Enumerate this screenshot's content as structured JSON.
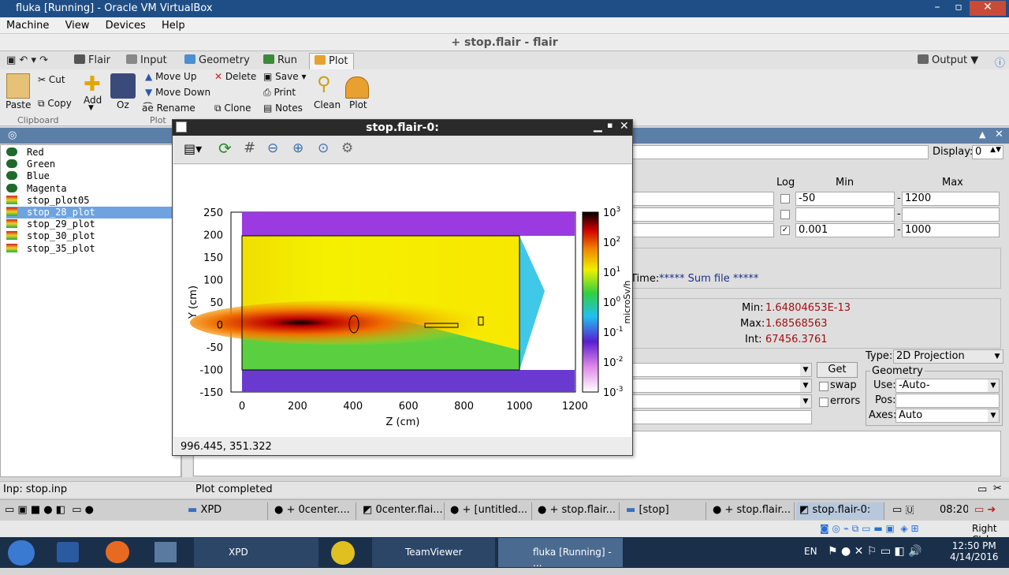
{
  "vbox": {
    "title": "fluka [Running] - Oracle VM VirtualBox",
    "menu": [
      "Machine",
      "View",
      "Devices",
      "Help"
    ]
  },
  "flair": {
    "title": "+ stop.flair - flair",
    "tabs": [
      "Flair",
      "Input",
      "Geometry",
      "Run",
      "Plot"
    ],
    "output_label": "Output",
    "ribbon": {
      "paste": "Paste",
      "cut": "Cut",
      "copy": "Copy",
      "add": "Add",
      "oz": "Oz",
      "move_up": "Move Up",
      "move_down": "Move Down",
      "rename": "Rename",
      "delete": "Delete",
      "clone": "Clone",
      "save": "Save",
      "print": "Print",
      "notes": "Notes",
      "clean": "Clean",
      "plot": "Plot",
      "sec_clipboard": "Clipboard",
      "sec_plot": "Plot"
    },
    "plot_list": [
      {
        "name": "Red",
        "kind": "pot"
      },
      {
        "name": "Green",
        "kind": "pot"
      },
      {
        "name": "Blue",
        "kind": "pot"
      },
      {
        "name": "Magenta",
        "kind": "pot"
      },
      {
        "name": "stop_plot05",
        "kind": "usr"
      },
      {
        "name": "stop_28_plot",
        "kind": "usr",
        "selected": true
      },
      {
        "name": "stop_29_plot",
        "kind": "usr"
      },
      {
        "name": "stop_30_plot",
        "kind": "usr"
      },
      {
        "name": "stop_35_plot",
        "kind": "usr"
      }
    ],
    "right": {
      "display_label": "Display:",
      "display_value": "0",
      "col_log": "Log",
      "col_min": "Min",
      "col_max": "Max",
      "row1": {
        "log": false,
        "min": "-50",
        "max": "1200"
      },
      "row2": {
        "log": false,
        "min": "",
        "max": ""
      },
      "row3": {
        "log": true,
        "min": "0.001",
        "max": "1000"
      },
      "time_label": "Time:",
      "time_value": "***** Sum file *****",
      "min_label": "Min:",
      "min_value": "1.64804653E-13",
      "max_label": "Max:",
      "max_value": "1.68568563",
      "int_label": "Int:",
      "int_value": "67456.3761",
      "type_label": "Type:",
      "type_value": "2D Projection",
      "get": "Get",
      "swap": "swap",
      "errors": "errors",
      "geometry": "Geometry",
      "use_label": "Use:",
      "use_value": "-Auto-",
      "pos_label": "Pos:",
      "axes_label": "Axes:",
      "axes_value": "Auto"
    },
    "status_left": "Inp: stop.inp",
    "status_right": "Plot completed"
  },
  "plotwin": {
    "title": "stop.flair-0:",
    "coords": "996.445,  351.322",
    "xlabel": "Z (cm)",
    "ylabel": "Y (cm)",
    "cblabel": "microSv/h",
    "xticks": [
      "0",
      "200",
      "400",
      "600",
      "800",
      "1000",
      "1200"
    ],
    "yticks": [
      "250",
      "200",
      "150",
      "100",
      "50",
      "0",
      "-50",
      "-100",
      "-150"
    ],
    "cbticks": [
      "3",
      "2",
      "1",
      "0",
      "-1",
      "-2",
      "-3"
    ]
  },
  "guest_taskbar": {
    "items": [
      "XPD",
      "+ 0center....",
      "0center.flai...",
      "+ [untitled...",
      "+ stop.flair...",
      "[stop]",
      "+ stop.flair...",
      "stop.flair-0:"
    ],
    "clock": "08:20"
  },
  "vb_status": {
    "hostkey": "Right Ctrl"
  },
  "win_taskbar": {
    "items": [
      "XPD",
      "TeamViewer",
      "fluka [Running] - ..."
    ],
    "lang": "EN",
    "time": "12:50 PM",
    "date": "4/14/2016"
  },
  "colors": {
    "vb_title": "#1f4e86",
    "selection": "#6fa3e0",
    "value_red": "#a01010",
    "value_blue": "#1c2f8a"
  }
}
